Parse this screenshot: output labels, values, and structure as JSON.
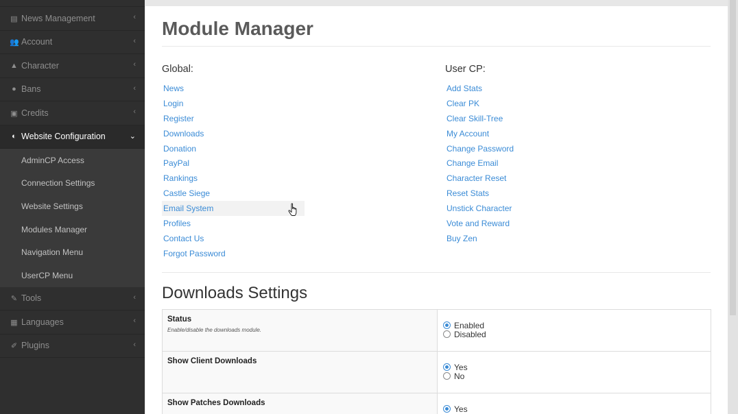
{
  "sidebar": {
    "items_top": [
      {
        "label": "News Management",
        "icon": "newspaper-icon"
      },
      {
        "label": "Account",
        "icon": "users-icon"
      },
      {
        "label": "Character",
        "icon": "user-icon"
      },
      {
        "label": "Bans",
        "icon": "exclamation-icon"
      },
      {
        "label": "Credits",
        "icon": "money-icon"
      }
    ],
    "active": {
      "label": "Website Configuration",
      "icon": "toggle-icon"
    },
    "subitems": [
      "AdminCP Access",
      "Connection Settings",
      "Website Settings",
      "Modules Manager",
      "Navigation Menu",
      "UserCP Menu"
    ],
    "items_bottom": [
      {
        "label": "Tools",
        "icon": "wrench-icon"
      },
      {
        "label": "Languages",
        "icon": "language-icon"
      },
      {
        "label": "Plugins",
        "icon": "plug-icon"
      }
    ]
  },
  "page": {
    "title": "Module Manager"
  },
  "global": {
    "heading": "Global:",
    "modules": [
      "News",
      "Login",
      "Register",
      "Downloads",
      "Donation",
      "PayPal",
      "Rankings",
      "Castle Siege",
      "Email System",
      "Profiles",
      "Contact Us",
      "Forgot Password"
    ]
  },
  "usercp": {
    "heading": "User CP:",
    "modules": [
      "Add Stats",
      "Clear PK",
      "Clear Skill-Tree",
      "My Account",
      "Change Password",
      "Change Email",
      "Character Reset",
      "Reset Stats",
      "Unstick Character",
      "Vote and Reward",
      "Buy Zen"
    ]
  },
  "downloads": {
    "title": "Downloads Settings",
    "rows": [
      {
        "name": "Status",
        "desc": "Enable/disable the downloads module.",
        "options": [
          "Enabled",
          "Disabled"
        ],
        "selected": 0
      },
      {
        "name": "Show Client Downloads",
        "desc": "",
        "options": [
          "Yes",
          "No"
        ],
        "selected": 0
      },
      {
        "name": "Show Patches Downloads",
        "desc": "",
        "options": [
          "Yes"
        ],
        "selected": 0
      }
    ]
  },
  "colors": {
    "link": "#3a8bd6",
    "sidebar": "#2f2f2f",
    "submenu": "#3a3a3a"
  }
}
